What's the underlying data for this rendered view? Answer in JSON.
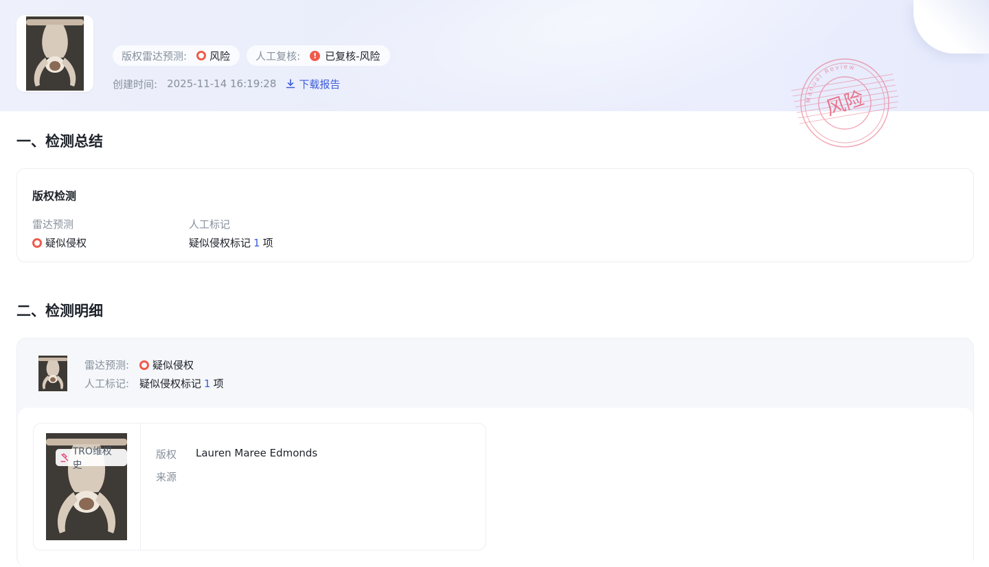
{
  "header": {
    "radar_label": "版权雷达预测:",
    "radar_value": "风险",
    "review_label": "人工复核:",
    "review_value": "已复核-风险",
    "created_label": "创建时间:",
    "created_value": "2025-11-14 16:19:28",
    "download_label": "下载报告"
  },
  "stamp": {
    "text": "风险",
    "arc_text": "Manual Review",
    "color": "#e8627a"
  },
  "section1": {
    "title": "一、检测总结",
    "card_title": "版权检测",
    "radar_label": "雷达预测",
    "radar_value": "疑似侵权",
    "manual_label": "人工标记",
    "manual_prefix": "疑似侵权标记",
    "manual_count": "1",
    "manual_suffix": "项"
  },
  "section2": {
    "title": "二、检测明细",
    "radar_label": "雷达预测:",
    "radar_value": "疑似侵权",
    "manual_label": "人工标记:",
    "manual_prefix": "疑似侵权标记",
    "manual_count": "1",
    "manual_suffix": "项",
    "match": {
      "tag": "TRO维权史",
      "copyright_label": "版权",
      "copyright_value": "Lauren Maree Edmonds",
      "source_label": "来源",
      "source_value": ""
    }
  },
  "colors": {
    "risk": "#f05a4a",
    "link": "#3b5bdb",
    "muted": "#86909c",
    "tag_icon": "#e8447a"
  },
  "icons": [
    "risk-ring-icon",
    "alert-icon",
    "download-icon",
    "gavel-icon"
  ]
}
